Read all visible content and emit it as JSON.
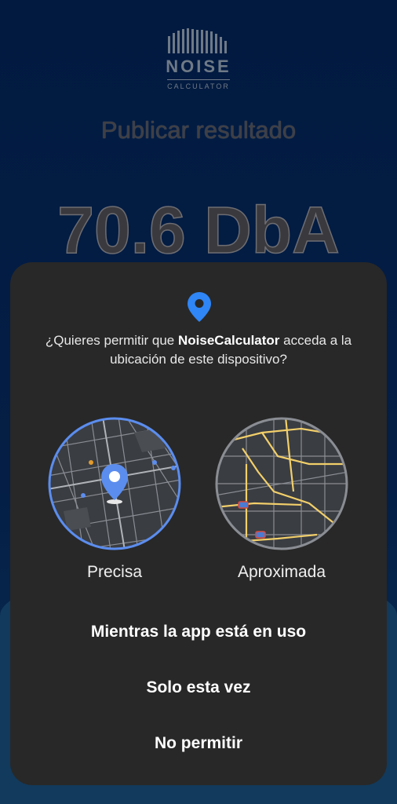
{
  "app": {
    "logo_title": "NOISE",
    "logo_subtitle": "CALCULATOR",
    "heading": "Publicar resultado",
    "measurement": "70.6 DbA"
  },
  "dialog": {
    "question_prefix": "¿Quieres permitir que ",
    "app_name": "NoiseCalculator",
    "question_suffix": " acceda a la ubicación de este dispositivo?",
    "options": {
      "precise_label": "Precisa",
      "approximate_label": "Aproximada",
      "selected": "Precisa"
    },
    "actions": {
      "while_in_use": "Mientras la app está en uso",
      "only_this_time": "Solo esta vez",
      "deny": "No permitir"
    }
  },
  "colors": {
    "accent": "#5b8dee",
    "dialog_bg": "#282828",
    "map_road": "#f2cf6a"
  },
  "icons": {
    "location": "location-pin-icon",
    "logo": "sound-wave-logo-icon"
  }
}
